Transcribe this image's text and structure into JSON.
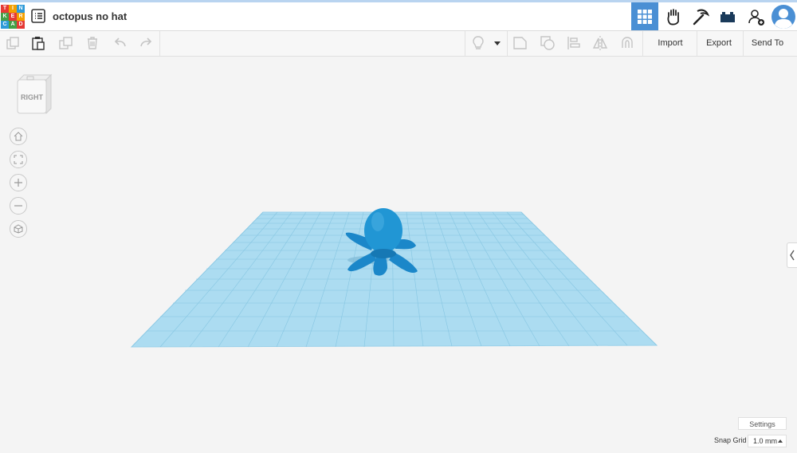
{
  "logo": {
    "letters": [
      "T",
      "I",
      "N",
      "K",
      "E",
      "R",
      "C",
      "A",
      "D"
    ],
    "colors": [
      "#e53935",
      "#f4a000",
      "#2e9ad8",
      "#43a047",
      "#e53935",
      "#f4a000",
      "#2e9ad8",
      "#43a047",
      "#e53935"
    ]
  },
  "document": {
    "title": "octopus no hat"
  },
  "header": {
    "buttons": [
      "grid-view-icon",
      "raised-hand-icon",
      "pickaxe-icon",
      "brick-icon",
      "add-user-icon",
      "user-avatar-icon"
    ],
    "active": "grid-view-icon"
  },
  "toolbar": {
    "import_label": "Import",
    "export_label": "Export",
    "send_to_label": "Send To"
  },
  "viewcube": {
    "face_label": "RIGHT"
  },
  "view_controls": [
    "home-view-icon",
    "fit-view-icon",
    "zoom-in-icon",
    "zoom-out-icon",
    "perspective-icon"
  ],
  "footer": {
    "settings_label": "Settings",
    "snap_grid_label": "Snap Grid",
    "snap_grid_value": "1.0 mm"
  },
  "colors": {
    "accent": "#4a8fd4",
    "workplane": "#a9daf0",
    "octopus": "#1b87c9"
  }
}
